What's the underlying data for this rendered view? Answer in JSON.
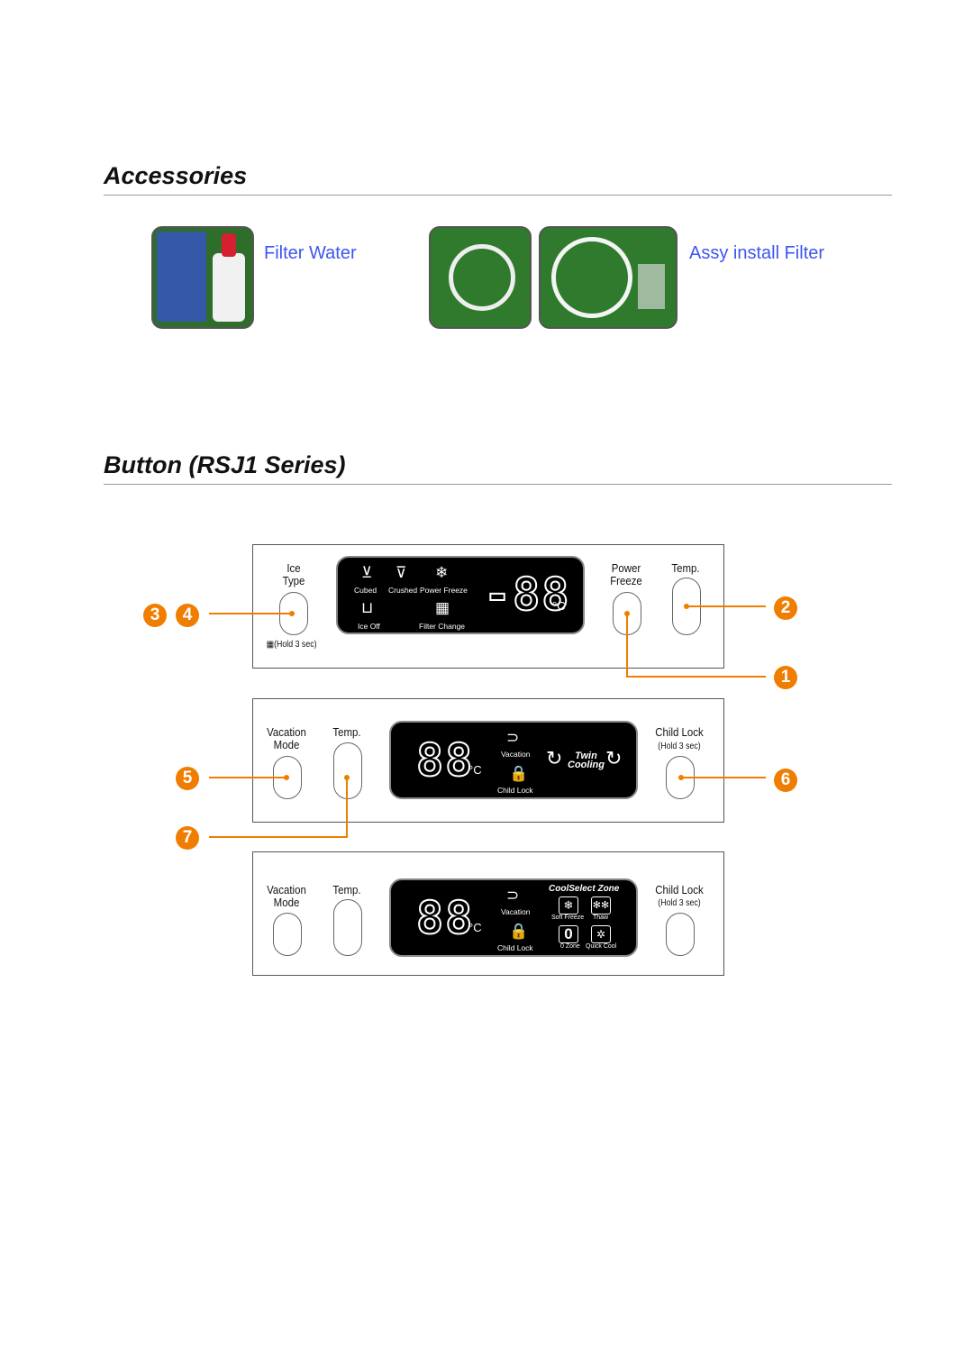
{
  "sections": {
    "accessories": {
      "title": "Accessories",
      "items": [
        {
          "label": "Filter Water"
        },
        {
          "label": "Assy install Filter"
        }
      ]
    },
    "buttons": {
      "title": "Button (RSJ1 Series)"
    }
  },
  "panel1": {
    "ice_type": "Ice\nType",
    "hold": "(Hold 3 sec)",
    "power_freeze": "Power\nFreeze",
    "temp": "Temp.",
    "display": {
      "cubed": "Cubed",
      "crushed": "Crushed",
      "power_freeze": "Power Freeze",
      "ice_off": "Ice Off",
      "filter_change": "Filter Change",
      "digits": "-88",
      "unit": "°C"
    }
  },
  "panel2": {
    "vacation": "Vacation\nMode",
    "temp": "Temp.",
    "child_lock": "Child Lock",
    "hold": "(Hold 3 sec)",
    "display": {
      "digits": "88",
      "unit": "°C",
      "vacation": "Vacation",
      "child_lock": "Child Lock",
      "twin": "Twin",
      "cooling": "Cooling"
    }
  },
  "panel3": {
    "vacation": "Vacation\nMode",
    "temp": "Temp.",
    "child_lock": "Child Lock",
    "hold": "(Hold 3 sec)",
    "display": {
      "digits": "88",
      "unit": "°C",
      "vacation": "Vacation",
      "child_lock": "Child Lock",
      "zone_title": "CoolSelect Zone",
      "soft_freeze": "Soft Freeze",
      "thaw": "Thaw",
      "zero_zone": "0 Zone",
      "quick_cool": "Quick Cool",
      "zero": "0"
    }
  },
  "callouts": [
    "1",
    "2",
    "3",
    "4",
    "5",
    "6",
    "7"
  ],
  "colors": {
    "accent": "#f07d00",
    "link": "#3d55f2",
    "display": "#000000"
  }
}
